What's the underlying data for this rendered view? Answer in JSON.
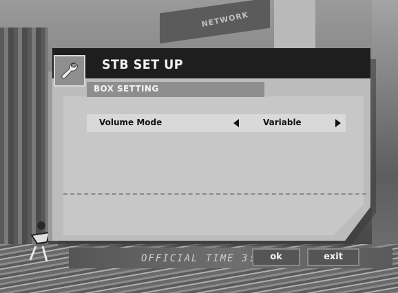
{
  "background": {
    "sign_text": "NETWORK",
    "ticker_text": "OFFICIAL TIME 3:"
  },
  "osd": {
    "icon": "wrench-icon",
    "title": "STB SET UP",
    "section": "BOX SETTING",
    "setting": {
      "label": "Volume Mode",
      "value": "Variable"
    }
  },
  "buttons": {
    "ok_label": "ok",
    "exit_label": "exit"
  }
}
